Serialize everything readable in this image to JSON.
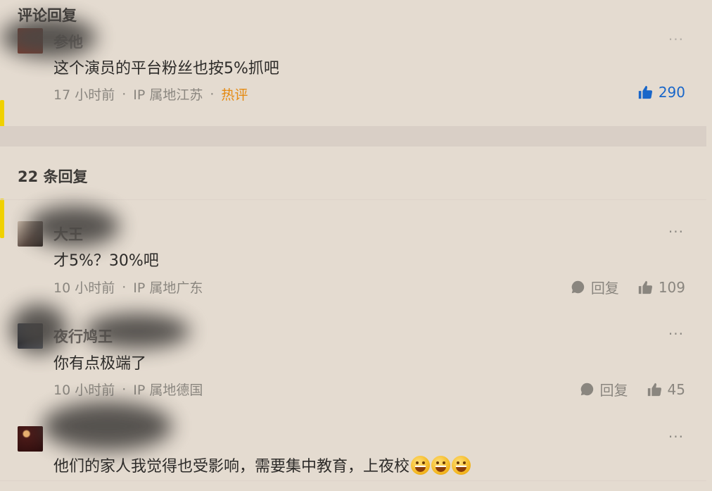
{
  "header": {
    "title": "评论回复"
  },
  "parent_comment": {
    "username": "参他",
    "content": "这个演员的平台粉丝也按5%抓吧",
    "time": "17 小时前",
    "location": "IP 属地江苏",
    "tag": "热评",
    "likes": "290",
    "more": "···"
  },
  "replies_header": {
    "title": "22 条回复"
  },
  "replies": [
    {
      "username": "大王",
      "content": "才5%？30%吧",
      "time": "10 小时前",
      "location": "IP 属地广东",
      "reply_label": "回复",
      "likes": "109",
      "more": "···"
    },
    {
      "username": "夜行鸠王",
      "content": "你有点极端了",
      "time": "10 小时前",
      "location": "IP 属地德国",
      "reply_label": "回复",
      "likes": "45",
      "more": "···"
    },
    {
      "username": "",
      "content": "他们的家人我觉得也受影响，需要集中教育，上夜校",
      "emojis": [
        "grinning-face-emoji",
        "grinning-face-emoji",
        "grinning-face-emoji"
      ],
      "more": "···"
    }
  ],
  "separator": "·",
  "colors": {
    "background": "#e4dbd0",
    "accent_like": "#1866c9",
    "hot_tag": "#e58a12",
    "meta_text": "#8a867f"
  }
}
